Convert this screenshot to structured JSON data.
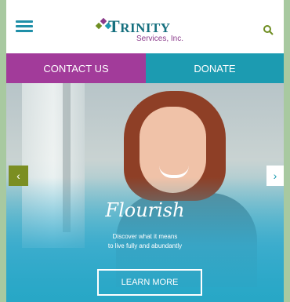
{
  "header": {
    "logo_name_first": "T",
    "logo_name_rest": "RINITY",
    "logo_sub": "Services, Inc.",
    "menu_icon": "hamburger-menu-icon",
    "search_icon": "search-icon"
  },
  "buttons": {
    "contact_label": "CONTACT US",
    "donate_label": "DONATE"
  },
  "hero": {
    "title": "Flourish",
    "text_line1": "Discover what it means",
    "text_line2": "to live fully and abundantly",
    "cta_label": "LEARN MORE",
    "prev_glyph": "‹",
    "next_glyph": "›"
  },
  "colors": {
    "contact_bg": "#a23b9a",
    "donate_bg": "#1c9bb1",
    "prev_arrow_bg": "#7b8e22",
    "brand_teal": "#16707f"
  }
}
